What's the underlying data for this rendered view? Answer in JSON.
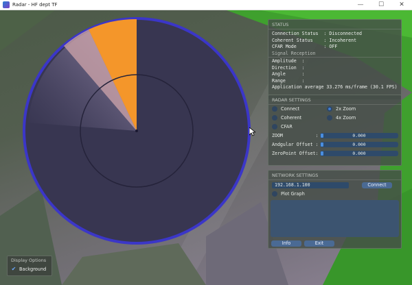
{
  "window": {
    "title": "Radar - HF dept TF",
    "minimize": "—",
    "maximize": "☐",
    "close": "✕"
  },
  "status": {
    "title": "STATUS",
    "rows": [
      "Connection Status  : Disconnected",
      "Coherent Status    : Incoherent",
      "CFAR Mode          : OFF"
    ],
    "signal_heading": "Signal Reception",
    "signal_rows": [
      "Amplitude  :",
      "Direction  :",
      "Angle      :",
      "Range      :"
    ],
    "fps": "Application average 33.276 ms/frame (30.1 FPS)"
  },
  "radar_settings": {
    "title": "RADAR SETTINGS",
    "connect": "Connect",
    "zoom2x": "2x Zoom",
    "coherent": "Coherent",
    "zoom4x": "4x Zoom",
    "cfar": "CFAR",
    "sliders": [
      {
        "label": "ZOOM            :",
        "value": "0.000"
      },
      {
        "label": "Andgular Offset :",
        "value": "0.000"
      },
      {
        "label": "ZeroPoint Offset:",
        "value": "0.000"
      }
    ]
  },
  "network": {
    "title": "NETWORK SETTINGS",
    "ip": "192.168.1.100",
    "connect_button": "Connect",
    "plot_graph": "Plot Graph",
    "info_button": "Info",
    "exit_button": "Exit"
  },
  "display_options": {
    "title": "Display Options",
    "background": "Background",
    "background_checked": true
  },
  "colors": {
    "radar_fill": "#383651",
    "radar_ring": "#3b36c8",
    "sweep": "#f4962a",
    "accent": "#3d7bd0"
  }
}
